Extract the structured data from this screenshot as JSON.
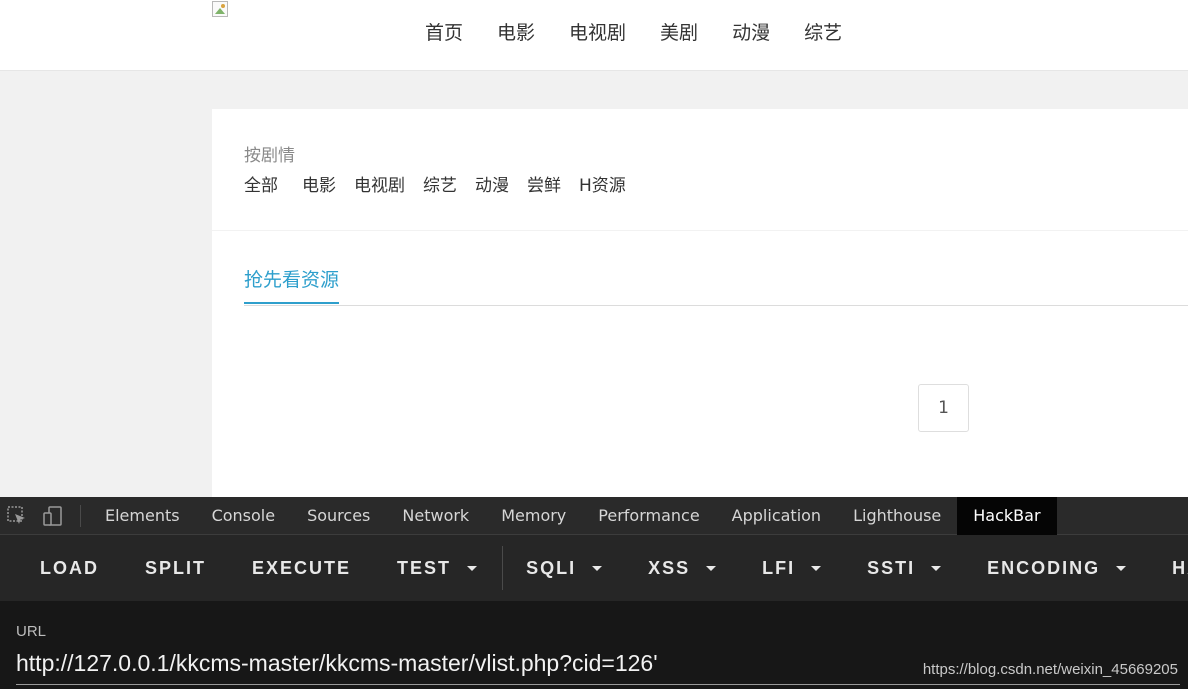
{
  "site": {
    "logo_icon": "broken-image-icon",
    "nav": [
      "首页",
      "电影",
      "电视剧",
      "美剧",
      "动漫",
      "综艺"
    ]
  },
  "filter": {
    "title": "按剧情",
    "links": [
      "全部",
      "电影",
      "电视剧",
      "综艺",
      "动漫",
      "尝鲜",
      "H资源"
    ]
  },
  "section": {
    "tab_label": "抢先看资源",
    "accent_color": "#2e9fcc"
  },
  "pagination": {
    "current_page": "1"
  },
  "devtools": {
    "icons": [
      "inspect-element-icon",
      "device-toolbar-icon"
    ],
    "tabs": [
      "Elements",
      "Console",
      "Sources",
      "Network",
      "Memory",
      "Performance",
      "Application",
      "Lighthouse",
      "HackBar"
    ],
    "active_tab": "HackBar"
  },
  "hackbar": {
    "buttons": {
      "load": "LOAD",
      "split": "SPLIT",
      "execute": "EXECUTE",
      "test": "TEST",
      "sqli": "SQLI",
      "xss": "XSS",
      "lfi": "LFI",
      "ssti": "SSTI",
      "encoding": "ENCODING",
      "hashing": "HASHING"
    },
    "url_label": "URL",
    "url_value": "http://127.0.0.1/kkcms-master/kkcms-master/vlist.php?cid=126'"
  },
  "watermark": "https://blog.csdn.net/weixin_45669205"
}
